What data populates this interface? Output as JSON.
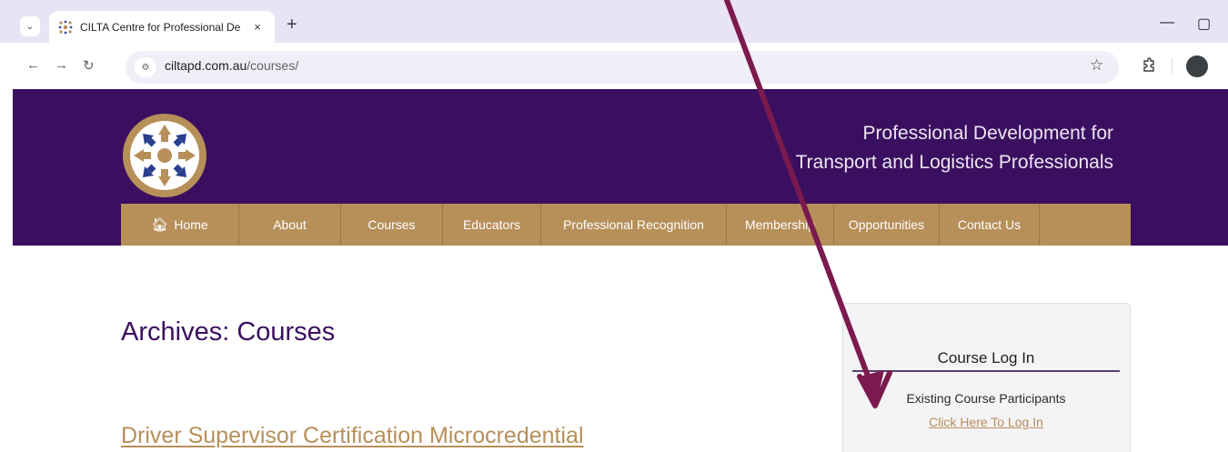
{
  "browser": {
    "tab_title": "CILTA Centre for Professional De",
    "tab_close": "×",
    "new_tab": "+",
    "url_host": "ciltapd.com.au",
    "url_path": "/courses/",
    "icons": [
      "tab-search-icon",
      "favicon-icon",
      "back-icon",
      "forward-icon",
      "reload-icon",
      "site-info-icon",
      "bookmark-star-icon",
      "extensions-icon",
      "profile-icon",
      "minimize-icon",
      "maximize-icon"
    ]
  },
  "header": {
    "tagline_line1": "Professional Development for",
    "tagline_line2": "Transport and Logistics Professionals"
  },
  "nav": {
    "items": [
      "Home",
      "About",
      "Courses",
      "Educators",
      "Professional Recognition",
      "Membership",
      "Opportunities",
      "Contact Us"
    ]
  },
  "content": {
    "page_title": "Archives: Courses",
    "post_title": "Driver Supervisor Certification Microcredential"
  },
  "sidebar": {
    "widget_title": "Course Log In",
    "widget_text": "Existing Course Participants",
    "widget_link": "Click Here To Log In"
  },
  "colors": {
    "header_purple": "#3b0f5f",
    "nav_gold": "#b78f59",
    "arrow": "#7a1a4e"
  }
}
